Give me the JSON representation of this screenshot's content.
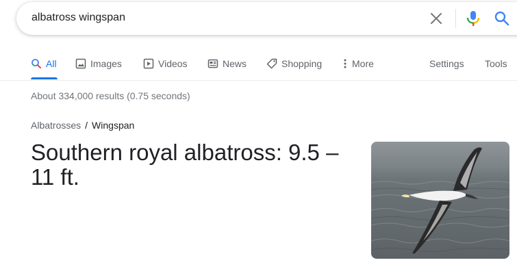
{
  "search": {
    "query": "albatross wingspan"
  },
  "tabs": [
    {
      "label": "All",
      "icon": "search-icon",
      "active": true
    },
    {
      "label": "Images",
      "icon": "image-icon"
    },
    {
      "label": "Videos",
      "icon": "video-icon"
    },
    {
      "label": "News",
      "icon": "news-icon"
    },
    {
      "label": "Shopping",
      "icon": "tag-icon"
    },
    {
      "label": "More",
      "icon": "more-vert-icon"
    }
  ],
  "tools": {
    "settings_label": "Settings",
    "tools_label": "Tools"
  },
  "result_stats": "About 334,000 results (0.75 seconds)",
  "breadcrumb": {
    "parent": "Albatrosses",
    "separator": "/",
    "current": "Wingspan"
  },
  "featured_answer": "Southern royal albatross: 9.5 – 11 ft.",
  "colors": {
    "accent": "#1a73e8",
    "text": "#202124",
    "muted": "#70757a"
  }
}
